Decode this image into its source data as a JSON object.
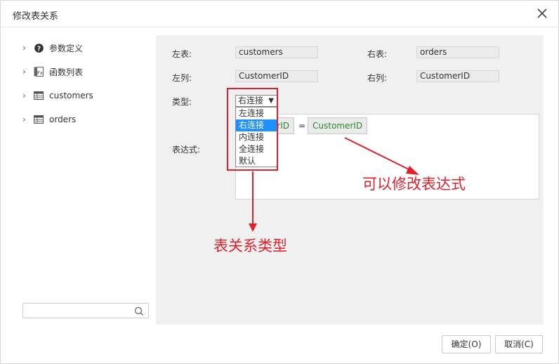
{
  "dialog": {
    "title": "修改表关系"
  },
  "tree": {
    "items": [
      {
        "label": "参数定义",
        "icon": "question-circle-icon"
      },
      {
        "label": "函数列表",
        "icon": "function-icon"
      },
      {
        "label": "customers",
        "icon": "table-icon"
      },
      {
        "label": "orders",
        "icon": "table-icon"
      }
    ]
  },
  "search": {
    "value": "",
    "placeholder": ""
  },
  "form": {
    "left_table_label": "左表:",
    "left_table_value": "customers",
    "right_table_label": "右表:",
    "right_table_value": "orders",
    "left_column_label": "左列:",
    "left_column_value": "CustomerID",
    "right_column_label": "右列:",
    "right_column_value": "CustomerID",
    "type_label": "类型:",
    "type_selected": "右连接",
    "type_options": [
      "左连接",
      "右连接",
      "内连接",
      "全连接",
      "默认"
    ],
    "expression_label": "表达式:",
    "expression_left": "rID",
    "expression_op": "=",
    "expression_right": "CustomerID"
  },
  "annotations": {
    "relation_type": "表关系类型",
    "edit_expression": "可以修改表达式"
  },
  "buttons": {
    "ok": "确定(O)",
    "cancel": "取消(C)"
  },
  "colors": {
    "accent": "#1e90ff",
    "annotation": "#e0202a",
    "expr_text": "#2a8a2a"
  }
}
